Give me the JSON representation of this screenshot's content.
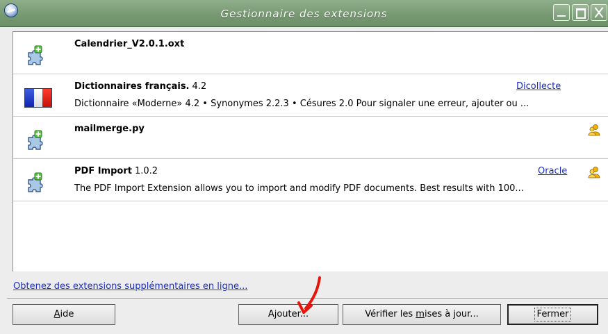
{
  "window": {
    "title": "Gestionnaire des extensions"
  },
  "extensions": [
    {
      "name": "Calendrier_V2.0.1.oxt",
      "version": "",
      "description": "",
      "publisher": "",
      "icon": "puzzle-piece-icon",
      "shared": false
    },
    {
      "name": "Dictionnaires français.",
      "version": "4.2",
      "description": "Dictionnaire «Moderne» 4.2 • Synonymes 2.2.3 • Césures 2.0  Pour signaler une erreur, ajouter ou ...",
      "publisher": "Dicollecte",
      "icon": "french-flag-icon",
      "shared": false
    },
    {
      "name": "mailmerge.py",
      "version": "",
      "description": "",
      "publisher": "",
      "icon": "puzzle-piece-icon",
      "shared": true
    },
    {
      "name": "PDF Import",
      "version": "1.0.2",
      "description": "The PDF Import Extension allows you to import and modify PDF documents. Best results with 100...",
      "publisher": "Oracle",
      "icon": "puzzle-piece-icon",
      "shared": true
    }
  ],
  "footer": {
    "online_link": "Obtenez des extensions supplémentaires en ligne...",
    "buttons": {
      "aide_mnemonic": "A",
      "aide_rest": "ide",
      "ajouter_prefix": "Ajouter...",
      "verifier_prefix": "Vérifier les ",
      "verifier_mnemonic": "m",
      "verifier_rest": "ises à jour...",
      "fermer": "Fermer"
    }
  },
  "colors": {
    "titlebar": "#789a73",
    "link": "#1a2ec8",
    "annotation": "#e8140c"
  }
}
